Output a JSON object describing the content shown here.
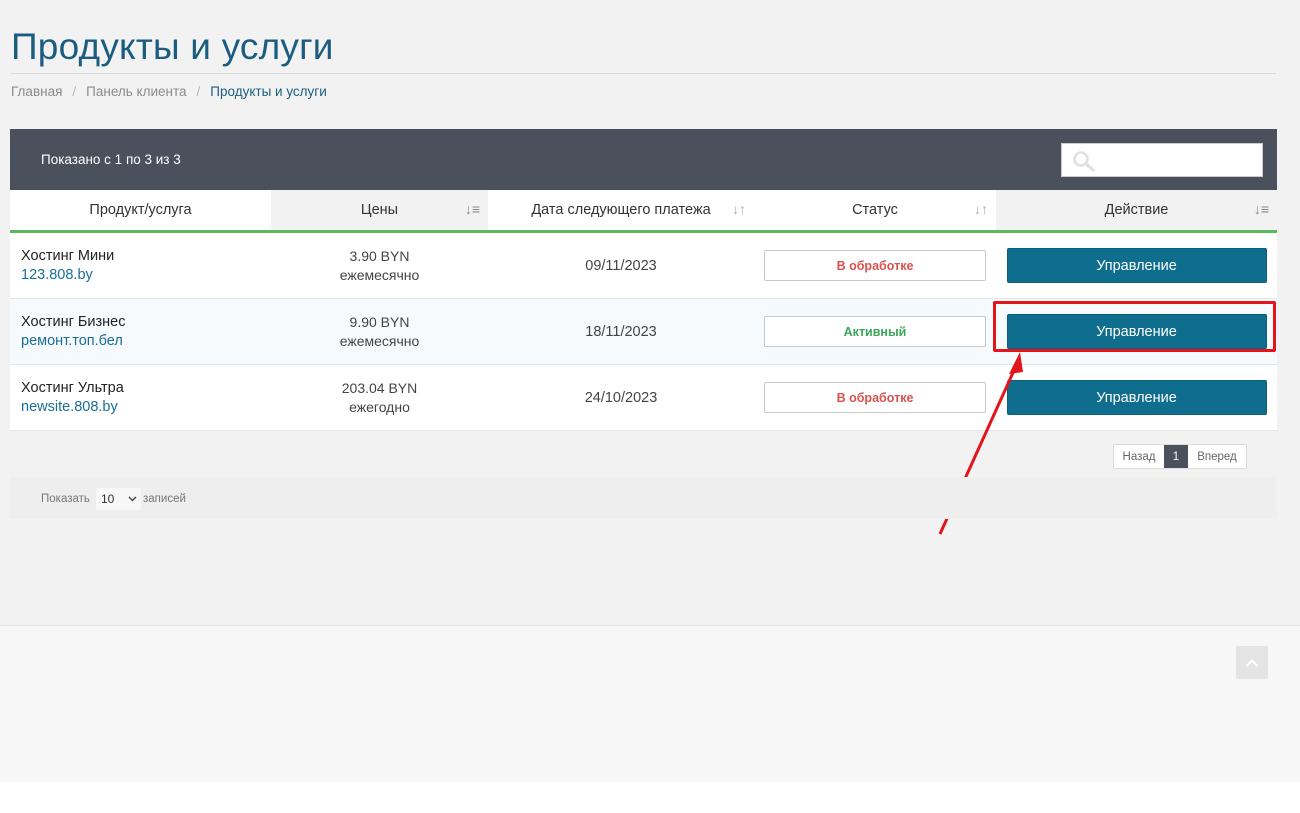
{
  "page": {
    "title": "Продукты и услуги"
  },
  "breadcrumb": {
    "items": [
      "Главная",
      "Панель клиента",
      "Продукты и услуги"
    ],
    "separator": "/"
  },
  "toolbar": {
    "info": "Показано с 1 по 3 из 3",
    "search": {
      "value": "",
      "icon": "search-icon"
    }
  },
  "table": {
    "columns": [
      "Продукт/услуга",
      "Цены",
      "Дата следующего платежа",
      "Статус",
      "Действие"
    ],
    "rows": [
      {
        "product": "Хостинг Мини",
        "domain": "123.808.by",
        "price": "3.90 BYN",
        "cycle": "ежемесячно",
        "date": "09/11/2023",
        "status": "В обработке",
        "action": "Управление"
      },
      {
        "product": "Хостинг Бизнес",
        "domain": "ремонт.топ.бел",
        "price": "9.90 BYN",
        "cycle": "ежемесячно",
        "date": "18/11/2023",
        "status": "Активный",
        "action": "Управление"
      },
      {
        "product": "Хостинг Ультра",
        "domain": "newsite.808.by",
        "price": "203.04 BYN",
        "cycle": "ежегодно",
        "date": "24/10/2023",
        "status": "В обработке",
        "action": "Управление"
      }
    ]
  },
  "pagination": {
    "prev": "Назад",
    "current": "1",
    "next": "Вперед"
  },
  "length": {
    "prefix": "Показать",
    "value": "10",
    "suffix": "записей"
  },
  "colors": {
    "title": "#1a5d80",
    "toolbar": "#4a505c",
    "button": "#0f6e8d",
    "header_underline": "#5cb85c",
    "status_pending": "#d9534f",
    "status_active": "#3aa757",
    "annotation": "#e3151b"
  }
}
